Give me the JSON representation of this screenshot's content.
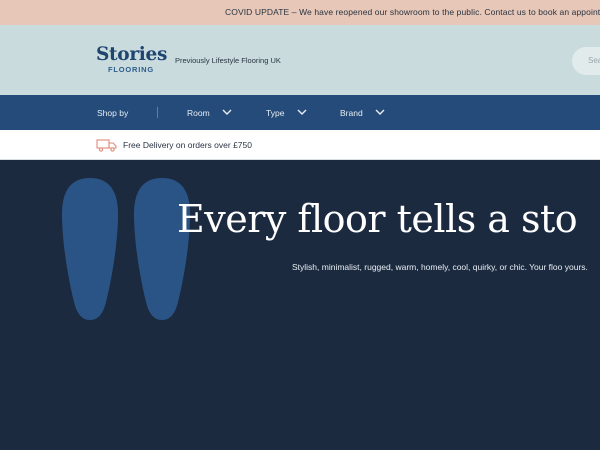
{
  "announcement": {
    "text": "COVID UPDATE – We have reopened our showroom to the public. Contact us to book an appointm"
  },
  "header": {
    "logo_main": "Stories",
    "logo_sub": "FLOORING",
    "tagline": "Previously Lifestyle Flooring UK",
    "search_placeholder": "Sea"
  },
  "nav": {
    "shop_by": "Shop by",
    "items": [
      {
        "label": "Room"
      },
      {
        "label": "Type"
      },
      {
        "label": "Brand"
      }
    ]
  },
  "delivery": {
    "text": "Free Delivery on orders over £750",
    "icon": "delivery-truck-icon"
  },
  "hero": {
    "title": "Every floor tells a sto",
    "subtitle": "Stylish, minimalist, rugged, warm, homely, cool, quirky, or chic. Your floo yours."
  },
  "colors": {
    "announcement_bg": "#e6c7b8",
    "header_bg": "#c9dbdc",
    "nav_bg": "#244b79",
    "hero_bg": "#1b2a3f",
    "quote_mark": "#2b5486",
    "logo": "#1f4470"
  }
}
